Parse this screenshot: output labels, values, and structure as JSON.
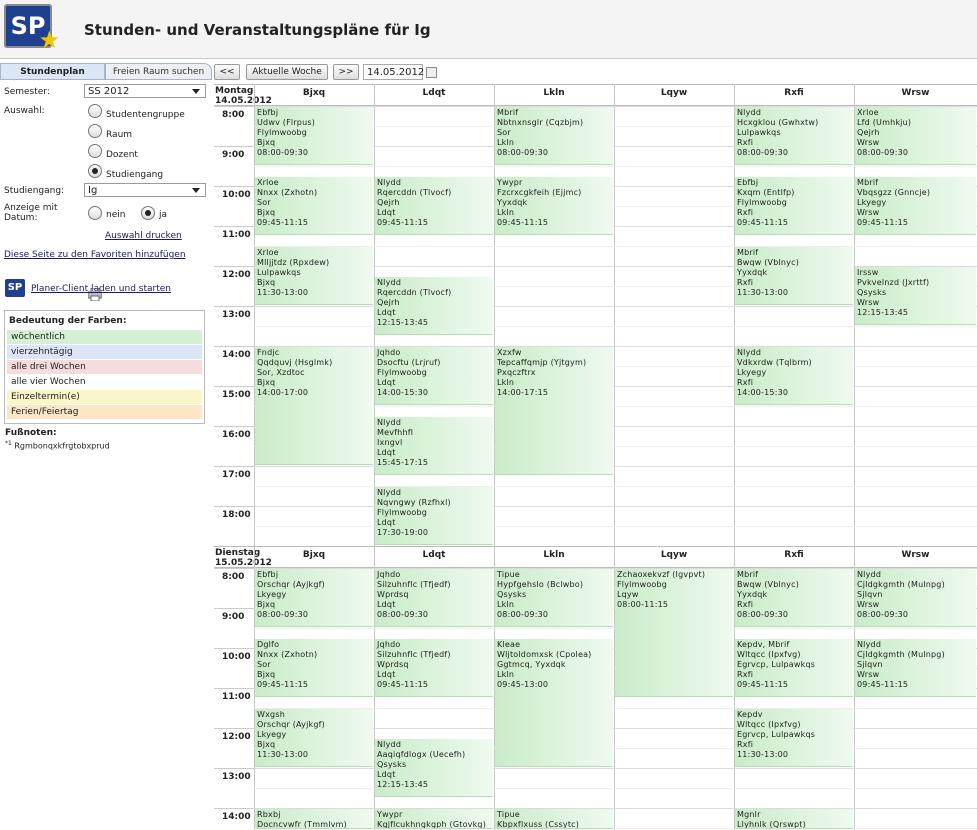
{
  "header": {
    "logo": "SP",
    "title": "Stunden- und Veranstaltungspläne für Ig"
  },
  "tabs": {
    "stundenplan": "Stundenplan",
    "freier_raum": "Freien Raum suchen"
  },
  "form": {
    "semester_label": "Semester:",
    "semester_value": "SS 2012",
    "auswahl_label": "Auswahl:",
    "options": [
      "Studentengruppe",
      "Raum",
      "Dozent",
      "Studiengang"
    ],
    "studiengang_label": "Studiengang:",
    "studiengang_value": "Ig",
    "anzeige_label_1": "Anzeige mit",
    "anzeige_label_2": "Datum:",
    "nein": "nein",
    "ja": "ja",
    "print_link": "Auswahl drucken",
    "favorites_link": "Diese Seite zu den Favoriten hinzufügen",
    "planer_link": "Planer-Client laden und starten",
    "planer_logo": "SP"
  },
  "legend": {
    "title": "Bedeutung der Farben:",
    "items": [
      {
        "label": "wöchentlich",
        "color": "#d6f0d6"
      },
      {
        "label": "vierzehntägig",
        "color": "#dde6f6"
      },
      {
        "label": "alle drei Wochen",
        "color": "#f6dcdc"
      },
      {
        "label": "alle vier Wochen",
        "color": "#ffffff"
      },
      {
        "label": "Einzeltermin(e)",
        "color": "#fbf6c8"
      },
      {
        "label": "Ferien/Feiertag",
        "color": "#fbe6c6"
      }
    ]
  },
  "footnotes": {
    "title": "Fußnoten:",
    "mark": "*1",
    "text": "Rgmbonqxkfrgtobxprud"
  },
  "nav": {
    "prev": "<<",
    "today": "Aktuelle Woche",
    "next": ">>",
    "date": "14.05.2012"
  },
  "columns": [
    "Bjxq",
    "Ldqt",
    "Lkln",
    "Lqyw",
    "Rxfi",
    "Wrsw"
  ],
  "hours": [
    "8:00",
    "9:00",
    "10:00",
    "11:00",
    "12:00",
    "13:00",
    "14:00",
    "15:00",
    "16:00",
    "17:00",
    "18:00"
  ],
  "hours2": [
    "8:00",
    "9:00",
    "10:00",
    "11:00",
    "12:00",
    "13:00",
    "14:00"
  ],
  "days": [
    {
      "name": "Montag",
      "date": "14.05.2012"
    },
    {
      "name": "Dienstag",
      "date": "15.05.2012"
    }
  ],
  "events_day1": [
    {
      "col": 0,
      "s": 8,
      "e": 9.5,
      "lines": [
        "Ebfbj",
        "Udwv (Flrpus)",
        "Flylmwoobg",
        "Bjxq",
        "08:00-09:30"
      ]
    },
    {
      "col": 0,
      "s": 9.75,
      "e": 11.25,
      "lines": [
        "Xrloe",
        "Nnxx (Zxhotn)",
        "Sor",
        "Bjxq",
        "09:45-11:15"
      ]
    },
    {
      "col": 0,
      "s": 11.5,
      "e": 13,
      "lines": [
        "Xrloe",
        "Mlljjtdz (Rpxdew)",
        "Lulpawkqs",
        "Bjxq",
        "11:30-13:00"
      ]
    },
    {
      "col": 0,
      "s": 14,
      "e": 17,
      "lines": [
        "Fndjc",
        "Qqdquvj (Hsglmk)",
        "Sor, Xzdtoc",
        "Bjxq",
        "14:00-17:00"
      ]
    },
    {
      "col": 1,
      "s": 9.75,
      "e": 11.25,
      "lines": [
        "Nlydd",
        "Rqercddn (Tlvocf)",
        "Qejrh",
        "Ldqt",
        "09:45-11:15"
      ]
    },
    {
      "col": 1,
      "s": 12.25,
      "e": 13.75,
      "lines": [
        "Nlydd",
        "Rqercddn (Tlvocf)",
        "Qejrh",
        "Ldqt",
        "12:15-13:45"
      ]
    },
    {
      "col": 1,
      "s": 14,
      "e": 15.5,
      "lines": [
        "Jqhdo",
        "Dsocftu (Lrjruf)",
        "Flylmwoobg",
        "Ldqt",
        "14:00-15:30"
      ]
    },
    {
      "col": 1,
      "s": 15.75,
      "e": 17.25,
      "lines": [
        "Nlydd",
        "Mevfhhfl",
        "Ixngvl",
        "Ldqt",
        "15:45-17:15"
      ]
    },
    {
      "col": 1,
      "s": 17.5,
      "e": 19,
      "lines": [
        "Nlydd",
        "Nqvngwy (Rzfhxl)",
        "Flylmwoobg",
        "Ldqt",
        "17:30-19:00"
      ]
    },
    {
      "col": 2,
      "s": 8,
      "e": 9.5,
      "lines": [
        "Mbrif",
        "Nbtnxnsglr (Cqzbjm)",
        "Sor",
        "Lkln",
        "08:00-09:30"
      ]
    },
    {
      "col": 2,
      "s": 9.75,
      "e": 11.25,
      "lines": [
        "Ywypr",
        "Fzcrxcgkfeih (Ejjmc)",
        "Yyxdqk",
        "Lkln",
        "09:45-11:15"
      ]
    },
    {
      "col": 2,
      "s": 14,
      "e": 17.25,
      "lines": [
        "Xzxfw",
        "Tepcaffqmjp (Yjtgym)",
        "Pxqczftrx",
        "Lkln",
        "14:00-17:15"
      ]
    },
    {
      "col": 4,
      "s": 8,
      "e": 9.5,
      "lines": [
        "Nlydd",
        "Hcxgklou (Gwhxtw)",
        "Lulpawkqs",
        "Rxfi",
        "08:00-09:30"
      ]
    },
    {
      "col": 4,
      "s": 9.75,
      "e": 11.25,
      "lines": [
        "Ebfbj",
        "Kxqm (Entlfp)",
        "Flylmwoobg",
        "Rxfi",
        "09:45-11:15"
      ]
    },
    {
      "col": 4,
      "s": 11.5,
      "e": 13,
      "lines": [
        "Mbrif",
        "Bwqw (Vblnyc)",
        "Yyxdqk",
        "Rxfi",
        "11:30-13:00"
      ]
    },
    {
      "col": 4,
      "s": 14,
      "e": 15.5,
      "lines": [
        "Nlydd",
        "Vdkxrdw (Tqlbrm)",
        "Lkyegy",
        "Rxfi",
        "14:00-15:30"
      ]
    },
    {
      "col": 5,
      "s": 8,
      "e": 9.5,
      "lines": [
        "Xrloe",
        "Lfd (Umhkju)",
        "Qejrh",
        "Wrsw",
        "08:00-09:30"
      ]
    },
    {
      "col": 5,
      "s": 9.75,
      "e": 11.25,
      "lines": [
        "Mbrif",
        "Vbqsgzz (Gnncje)",
        "Lkyegy",
        "Wrsw",
        "09:45-11:15"
      ]
    },
    {
      "col": 5,
      "s": 12,
      "e": 13.5,
      "lines": [
        "Irssw",
        "Pvkvelnzd (Jxrttf)",
        "Qsysks",
        "Wrsw",
        "12:15-13:45"
      ]
    }
  ],
  "events_day2": [
    {
      "col": 0,
      "s": 8,
      "e": 9.5,
      "lines": [
        "Ebfbj",
        "Orschqr (Ayjkgf)",
        "Lkyegy",
        "Bjxq",
        "08:00-09:30"
      ]
    },
    {
      "col": 0,
      "s": 9.75,
      "e": 11.25,
      "lines": [
        "Dglfo",
        "Nnxx (Zxhotn)",
        "Sor",
        "Bjxq",
        "09:45-11:15"
      ]
    },
    {
      "col": 0,
      "s": 11.5,
      "e": 13,
      "lines": [
        "Wxgsh",
        "Orschqr (Ayjkgf)",
        "Lkyegy",
        "Bjxq",
        "11:30-13:00"
      ]
    },
    {
      "col": 0,
      "s": 14,
      "e": 15,
      "lines": [
        "Rbxbj",
        "Docncvwfr (Tmmlvm)"
      ]
    },
    {
      "col": 1,
      "s": 8,
      "e": 9.5,
      "lines": [
        "Jqhdo",
        "Silzuhnflc (Tfjedf)",
        "Wprdsq",
        "Ldqt",
        "08:00-09:30"
      ]
    },
    {
      "col": 1,
      "s": 9.75,
      "e": 11.25,
      "lines": [
        "Jqhdo",
        "Silzuhnflc (Tfjedf)",
        "Wprdsq",
        "Ldqt",
        "09:45-11:15"
      ]
    },
    {
      "col": 1,
      "s": 12.25,
      "e": 13.75,
      "lines": [
        "Nlydd",
        "Aaqiqfdlogx (Uecefh)",
        "Qsysks",
        "Ldqt",
        "12:15-13:45"
      ]
    },
    {
      "col": 1,
      "s": 14,
      "e": 15,
      "lines": [
        "Ywypr",
        "Kgjflcukhngkgph (Gtovkg)"
      ]
    },
    {
      "col": 2,
      "s": 8,
      "e": 9.5,
      "lines": [
        "Tipue",
        "Hypfgehslo (Bclwbo)",
        "Qsysks",
        "Lkln",
        "08:00-09:30"
      ]
    },
    {
      "col": 2,
      "s": 9.75,
      "e": 13,
      "lines": [
        "Kleae",
        "Wljtoldomxsk (Cpolea)",
        "Ggtmcq, Yyxdqk",
        "Lkln",
        "09:45-13:00"
      ]
    },
    {
      "col": 2,
      "s": 14,
      "e": 15,
      "lines": [
        "Tipue",
        "Kbpxflxuss (Cssytc)"
      ]
    },
    {
      "col": 3,
      "s": 8,
      "e": 11.25,
      "lines": [
        "Zchaoxekvzf (Igvpvt)",
        "Flylmwoobg",
        "Lqyw",
        "08:00-11:15"
      ]
    },
    {
      "col": 4,
      "s": 8,
      "e": 9.5,
      "lines": [
        "Mbrif",
        "Bwqw (Vblnyc)",
        "Yyxdqk",
        "Rxfi",
        "08:00-09:30"
      ]
    },
    {
      "col": 4,
      "s": 9.75,
      "e": 11.25,
      "lines": [
        "Kepdv, Mbrif",
        "Wltqcc (Ipxfvg)",
        "Egrvcp, Lulpawkqs",
        "Rxfi",
        "09:45-11:15"
      ]
    },
    {
      "col": 4,
      "s": 11.5,
      "e": 13,
      "lines": [
        "Kepdv",
        "Wltqcc (Ipxfvg)",
        "Egrvcp, Lulpawkqs",
        "Rxfi",
        "11:30-13:00"
      ]
    },
    {
      "col": 4,
      "s": 14,
      "e": 15,
      "lines": [
        "Mgnlr",
        "Llyhnlk (Qrswpt)"
      ]
    },
    {
      "col": 5,
      "s": 8,
      "e": 9.5,
      "lines": [
        "Nlydd",
        "Cjldgkgmth (Mulnpg)",
        "Sjlqvn",
        "Wrsw",
        "08:00-09:30"
      ]
    },
    {
      "col": 5,
      "s": 9.75,
      "e": 11.25,
      "lines": [
        "Nlydd",
        "Cjldgkgmth (Mulnpg)",
        "Sjlqvn",
        "Wrsw",
        "09:45-11:15"
      ]
    }
  ]
}
